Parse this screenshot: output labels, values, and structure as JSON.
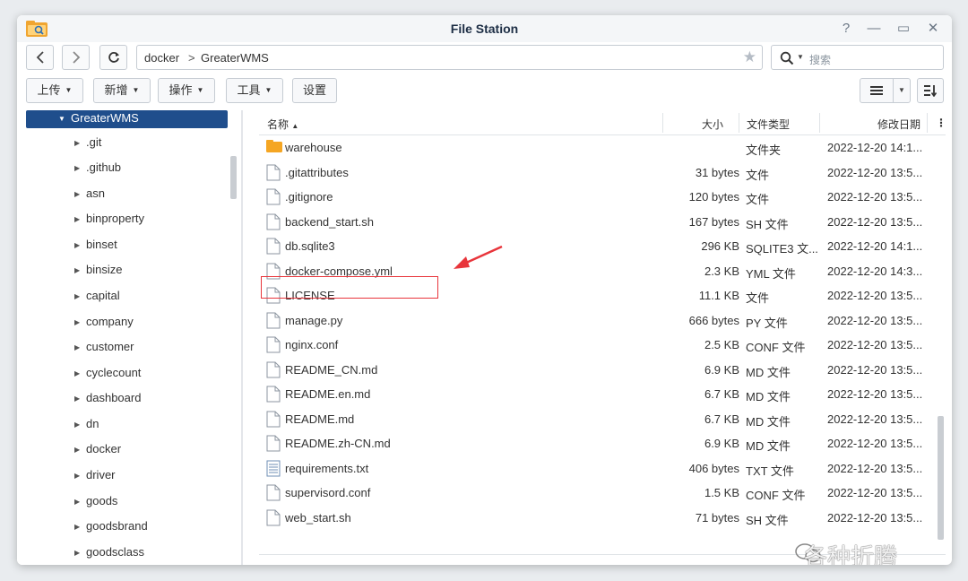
{
  "window": {
    "title": "File Station"
  },
  "title_controls": [
    "?",
    "—",
    "▭",
    "✕"
  ],
  "path": {
    "crumbs": [
      "docker",
      "GreaterWMS"
    ],
    "separator": ">"
  },
  "search": {
    "placeholder": "搜索"
  },
  "toolbar": {
    "upload": "上传",
    "new": "新增",
    "action": "操作",
    "tools": "工具",
    "settings": "设置"
  },
  "sidebar": {
    "selected": "GreaterWMS",
    "items": [
      ".git",
      ".github",
      "asn",
      "binproperty",
      "binset",
      "binsize",
      "capital",
      "company",
      "customer",
      "cyclecount",
      "dashboard",
      "dn",
      "docker",
      "driver",
      "goods",
      "goodsbrand",
      "goodsclass"
    ]
  },
  "columns": {
    "name": "名称",
    "size": "大小",
    "type": "文件类型",
    "modified": "修改日期",
    "sort_indicator": "▲",
    "more": "⋮"
  },
  "files": [
    {
      "name": "warehouse",
      "size": "",
      "type": "文件夹",
      "modified": "2022-12-20 14:1...",
      "icon": "folder-icon"
    },
    {
      "name": ".gitattributes",
      "size": "31 bytes",
      "type": "文件",
      "modified": "2022-12-20 13:5...",
      "icon": "file-icon"
    },
    {
      "name": ".gitignore",
      "size": "120 bytes",
      "type": "文件",
      "modified": "2022-12-20 13:5...",
      "icon": "file-icon"
    },
    {
      "name": "backend_start.sh",
      "size": "167 bytes",
      "type": "SH 文件",
      "modified": "2022-12-20 13:5...",
      "icon": "file-icon"
    },
    {
      "name": "db.sqlite3",
      "size": "296 KB",
      "type": "SQLITE3 文...",
      "modified": "2022-12-20 14:1...",
      "icon": "file-icon"
    },
    {
      "name": "docker-compose.yml",
      "size": "2.3 KB",
      "type": "YML 文件",
      "modified": "2022-12-20 14:3...",
      "icon": "file-icon"
    },
    {
      "name": "LICENSE",
      "size": "11.1 KB",
      "type": "文件",
      "modified": "2022-12-20 13:5...",
      "icon": "file-icon"
    },
    {
      "name": "manage.py",
      "size": "666 bytes",
      "type": "PY 文件",
      "modified": "2022-12-20 13:5...",
      "icon": "file-icon"
    },
    {
      "name": "nginx.conf",
      "size": "2.5 KB",
      "type": "CONF 文件",
      "modified": "2022-12-20 13:5...",
      "icon": "file-icon"
    },
    {
      "name": "README_CN.md",
      "size": "6.9 KB",
      "type": "MD 文件",
      "modified": "2022-12-20 13:5...",
      "icon": "file-icon"
    },
    {
      "name": "README.en.md",
      "size": "6.7 KB",
      "type": "MD 文件",
      "modified": "2022-12-20 13:5...",
      "icon": "file-icon"
    },
    {
      "name": "README.md",
      "size": "6.7 KB",
      "type": "MD 文件",
      "modified": "2022-12-20 13:5...",
      "icon": "file-icon"
    },
    {
      "name": "README.zh-CN.md",
      "size": "6.9 KB",
      "type": "MD 文件",
      "modified": "2022-12-20 13:5...",
      "icon": "file-icon"
    },
    {
      "name": "requirements.txt",
      "size": "406 bytes",
      "type": "TXT 文件",
      "modified": "2022-12-20 13:5...",
      "icon": "text-file-icon"
    },
    {
      "name": "supervisord.conf",
      "size": "1.5 KB",
      "type": "CONF 文件",
      "modified": "2022-12-20 13:5...",
      "icon": "file-icon"
    },
    {
      "name": "web_start.sh",
      "size": "71 bytes",
      "type": "SH 文件",
      "modified": "2022-12-20 13:5...",
      "icon": "file-icon"
    }
  ],
  "watermark": {
    "text": "各种折腾"
  },
  "colors": {
    "selected": "#1f4e8c",
    "highlight": "#e8353b",
    "folder": "#f5a623"
  }
}
